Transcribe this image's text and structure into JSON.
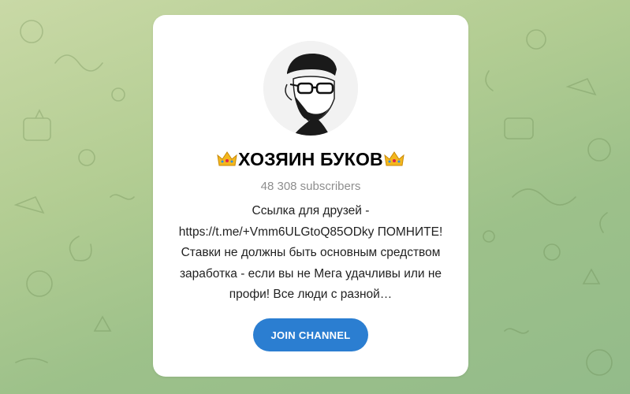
{
  "channel": {
    "title": "ХОЗЯИН БУКОВ",
    "title_emoji_left": "crown-icon",
    "title_emoji_right": "crown-icon",
    "subscribers": "48 308 subscribers",
    "description_lines": [
      "Ссылка для друзей -",
      "https://t.me/+Vmm6ULGtoQ85ODky ПОМНИТЕ!",
      "Ставки не должны быть основным средством",
      "заработка - если вы не Мега удачливы или не",
      "профи! Все люди с разной…"
    ]
  },
  "actions": {
    "join_label": "JOIN CHANNEL"
  },
  "colors": {
    "accent": "#2b7ed1",
    "background": "#a8c78f",
    "card": "#ffffff"
  }
}
